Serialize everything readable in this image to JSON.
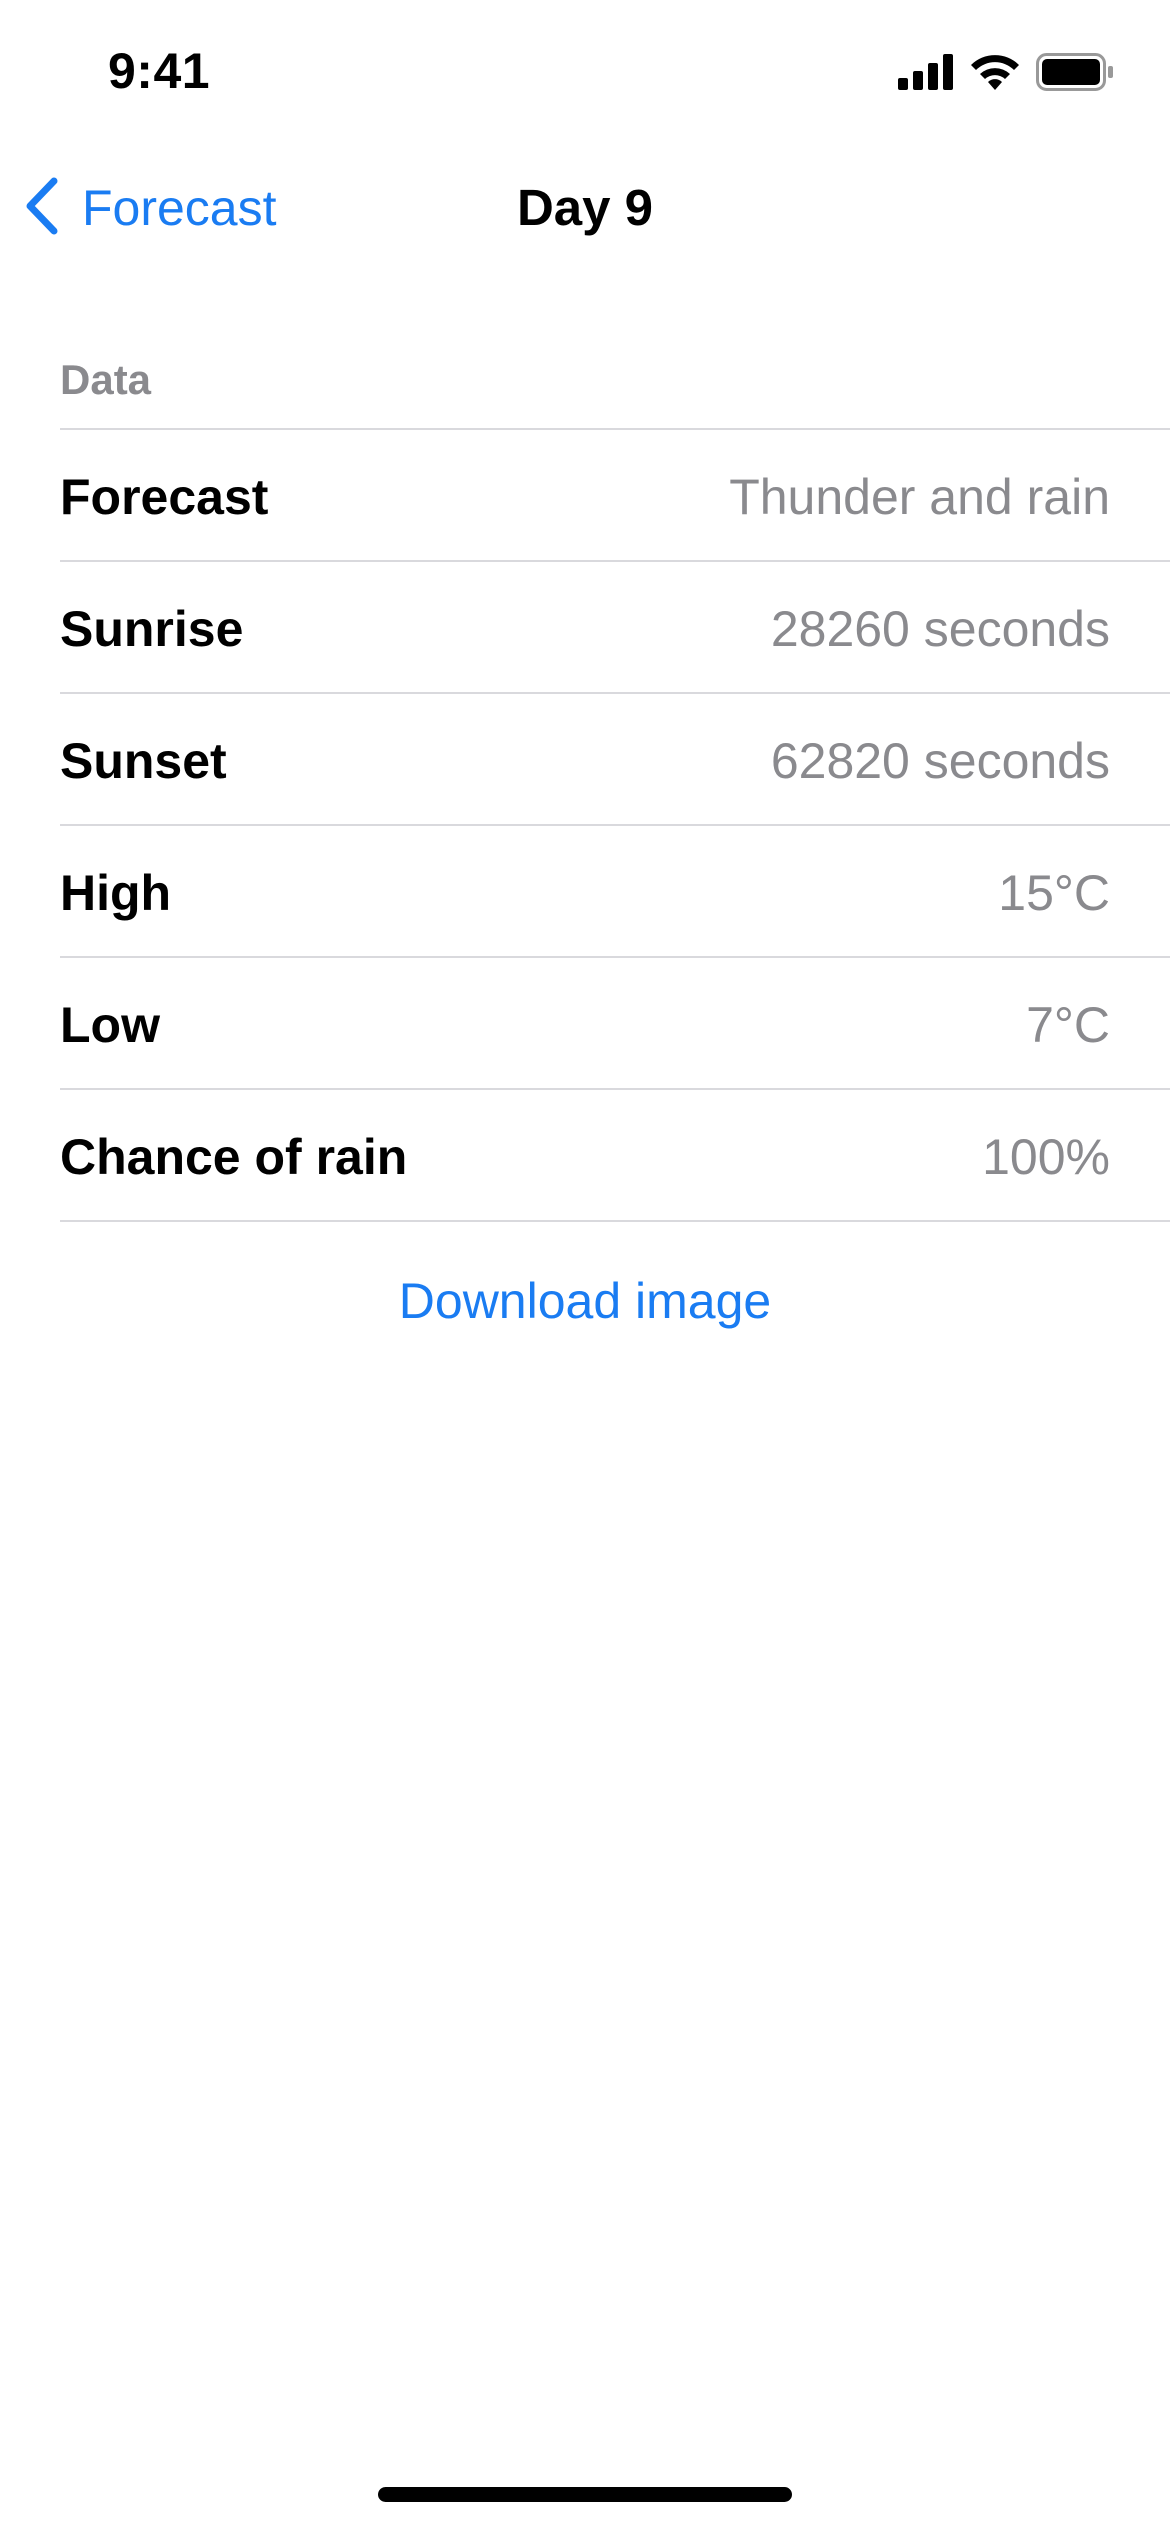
{
  "status_bar": {
    "time": "9:41",
    "icons": [
      "cellular-signal-icon",
      "wifi-icon",
      "battery-icon"
    ]
  },
  "nav": {
    "back_label": "Forecast",
    "back_icon": "chevron-left-icon",
    "title": "Day 9"
  },
  "section": {
    "header": "Data",
    "rows": [
      {
        "label": "Forecast",
        "value": "Thunder and rain"
      },
      {
        "label": "Sunrise",
        "value": "28260 seconds"
      },
      {
        "label": "Sunset",
        "value": "62820 seconds"
      },
      {
        "label": "High",
        "value": "15°C"
      },
      {
        "label": "Low",
        "value": "7°C"
      },
      {
        "label": "Chance of rain",
        "value": "100%"
      }
    ]
  },
  "actions": {
    "download_label": "Download image"
  },
  "colors": {
    "accent": "#1a7cf2",
    "secondary_text": "#8a8a8e",
    "separator": "#d9d9dd"
  }
}
